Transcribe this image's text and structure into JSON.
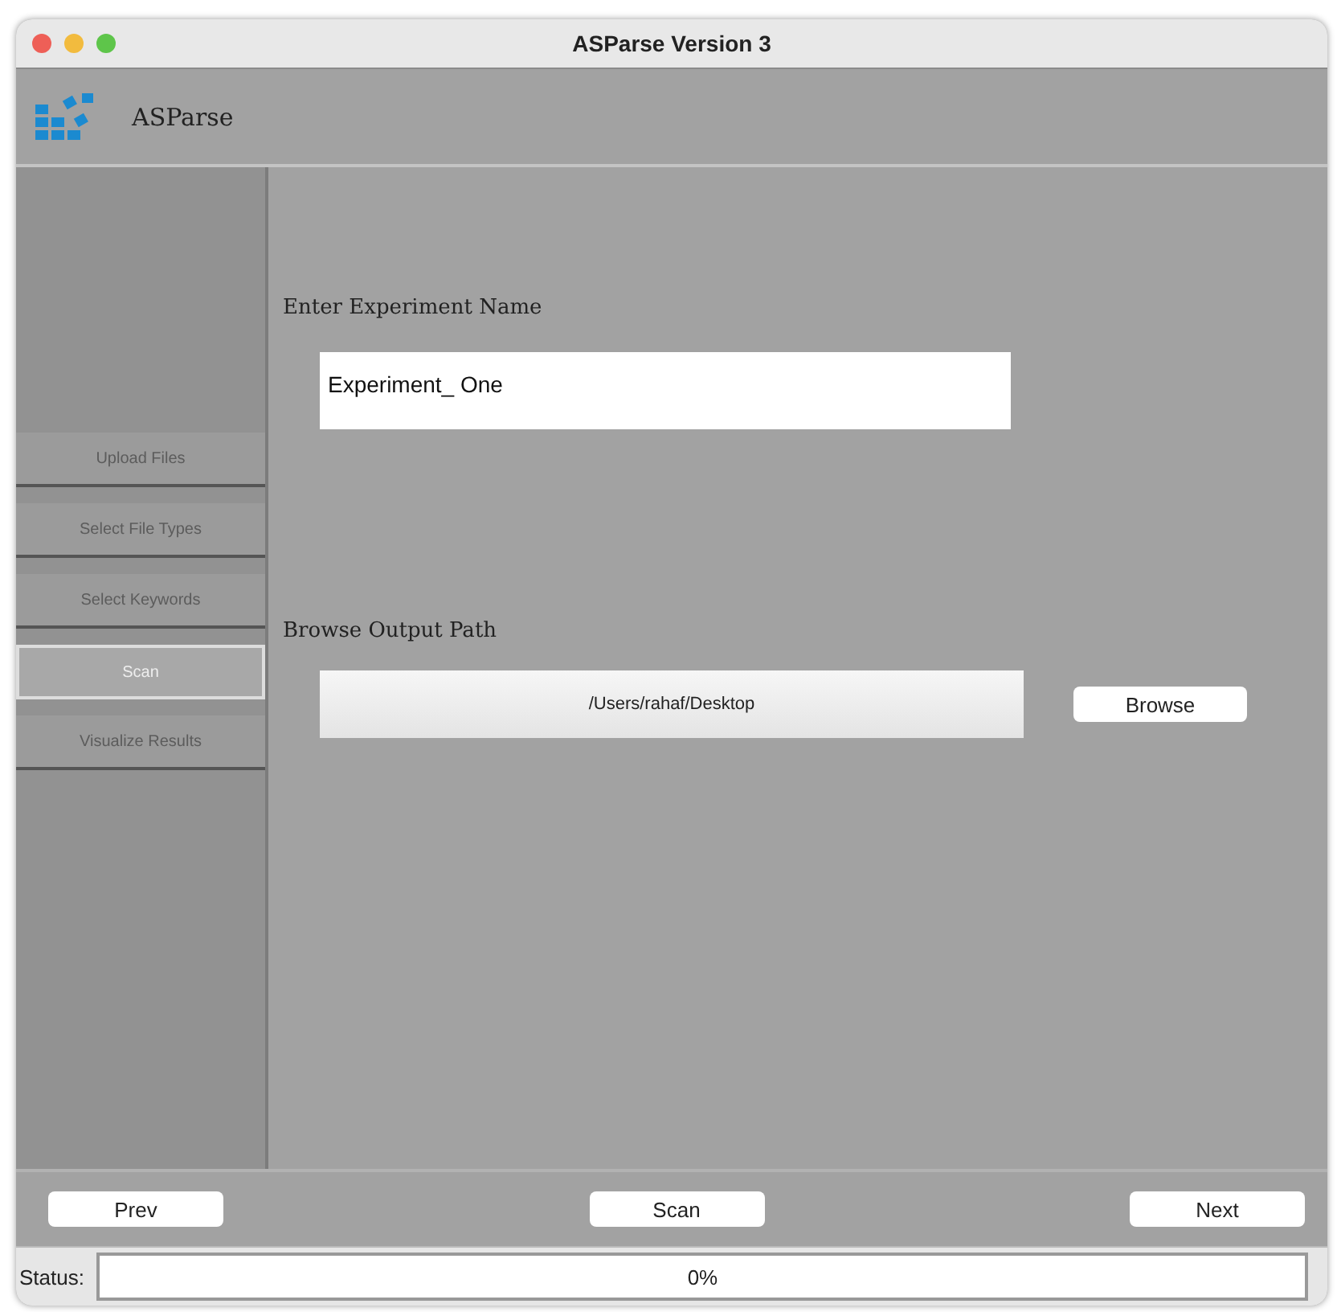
{
  "window": {
    "title": "ASParse Version 3"
  },
  "header": {
    "app_name": "ASParse"
  },
  "sidebar": {
    "items": [
      {
        "label": "Upload Files",
        "selected": false,
        "disabled": true
      },
      {
        "label": "Select File Types",
        "selected": false,
        "disabled": true
      },
      {
        "label": "Select Keywords",
        "selected": false,
        "disabled": true
      },
      {
        "label": "Scan",
        "selected": true,
        "disabled": false
      },
      {
        "label": "Visualize Results",
        "selected": false,
        "disabled": true
      }
    ]
  },
  "experiment": {
    "label": "Enter Experiment Name",
    "value": "Experiment_ One"
  },
  "output": {
    "label": "Browse Output Path",
    "path": "/Users/rahaf/Desktop",
    "button": "Browse"
  },
  "nav": {
    "prev": "Prev",
    "scan": "Scan",
    "next": "Next"
  },
  "status": {
    "label": "Status:",
    "reading": "0%"
  }
}
